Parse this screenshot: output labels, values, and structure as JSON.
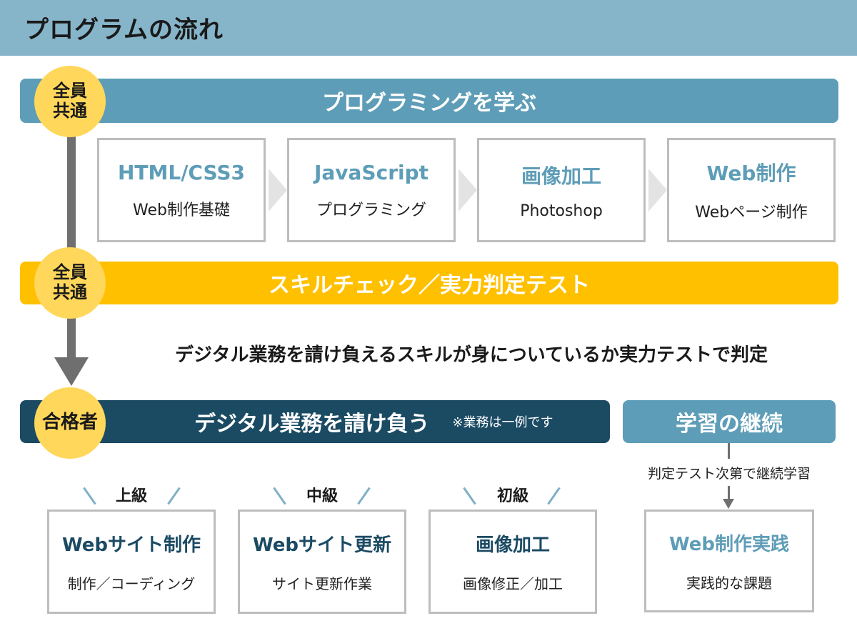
{
  "header": {
    "title": "プログラムの流れ"
  },
  "circles": [
    {
      "line1": "全員",
      "line2": "共通"
    },
    {
      "line1": "全員",
      "line2": "共通"
    },
    {
      "line1": "合格者"
    }
  ],
  "banners": {
    "learn": "プログラミングを学ぶ",
    "skill": "スキルチェック／実力判定テスト",
    "digital": "デジタル業務を請け負う",
    "digital_note": "※業務は一例です",
    "continue": "学習の継続"
  },
  "courses": [
    {
      "title": "HTML/CSS3",
      "subtitle": "Web制作基礎"
    },
    {
      "title": "JavaScript",
      "subtitle": "プログラミング"
    },
    {
      "title": "画像加工",
      "subtitle": "Photoshop"
    },
    {
      "title": "Web制作",
      "subtitle": "Webページ制作"
    }
  ],
  "skill_description": "デジタル業務を請け負えるスキルが身についているか実力テストで判定",
  "levels": [
    {
      "label": "上級",
      "title": "Webサイト制作",
      "subtitle": "制作／コーディング"
    },
    {
      "label": "中級",
      "title": "Webサイト更新",
      "subtitle": "サイト更新作業"
    },
    {
      "label": "初級",
      "title": "画像加工",
      "subtitle": "画像修正／加工"
    }
  ],
  "continue": {
    "description": "判定テスト次第で継続学習",
    "title": "Web制作実践",
    "subtitle": "実践的な課題"
  },
  "colors": {
    "header": "#86b5ca",
    "learn_banner": "#5e9db7",
    "skill_banner": "#ffc000",
    "digital_banner": "#1b4a63",
    "circle": "#ffd75a"
  }
}
